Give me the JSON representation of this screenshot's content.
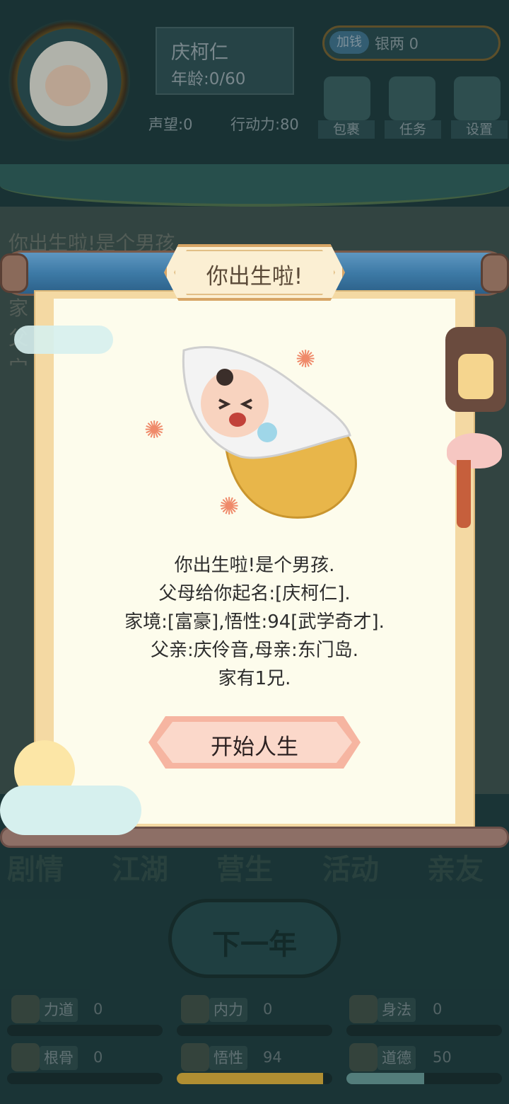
{
  "header": {
    "name": "庆柯仁",
    "age": "年龄:0/60",
    "reputation": "声望:0",
    "stamina": "行动力:80",
    "money_button": "加钱",
    "money": "银两 0",
    "icons": [
      {
        "label": "包裹",
        "icon": "gift-box-icon"
      },
      {
        "label": "任务",
        "icon": "book-icon"
      },
      {
        "label": "设置",
        "icon": "gear-icon"
      }
    ]
  },
  "log": {
    "lines": [
      "你出生啦!是个男孩.",
      "家",
      "父",
      "宀"
    ]
  },
  "tabs": [
    "剧情",
    "江湖",
    "营生",
    "活动",
    "亲友"
  ],
  "next_year": "下一年",
  "attributes": [
    {
      "name": "力道",
      "value": "0",
      "fill": 0.0,
      "icon": "arm-icon"
    },
    {
      "name": "内力",
      "value": "0",
      "fill": 0.0,
      "icon": "energy-icon"
    },
    {
      "name": "身法",
      "value": "0",
      "fill": 0.0,
      "icon": "swallow-icon"
    },
    {
      "name": "根骨",
      "value": "0",
      "fill": 0.0,
      "icon": "bone-icon"
    },
    {
      "name": "悟性",
      "value": "94",
      "fill": 0.94,
      "icon": "brain-icon"
    },
    {
      "name": "道德",
      "value": "50",
      "fill": 0.5,
      "icon": "scroll-book-icon"
    }
  ],
  "dialog": {
    "title": "你出生啦!",
    "lines": [
      "你出生啦!是个男孩.",
      "父母给你起名:[庆柯仁].",
      "家境:[富豪],悟性:94[武学奇才].",
      "父亲:庆伶音,母亲:东门岛.",
      "家有1兄."
    ],
    "button": "开始人生"
  },
  "colors": {
    "paper": "#fdfcec",
    "scroll_rod": "#3d7aa6",
    "button": "#fbd8ca",
    "bar_fill_wisdom": "#c9a23a",
    "bar_fill_morality": "#5f8f8c"
  }
}
